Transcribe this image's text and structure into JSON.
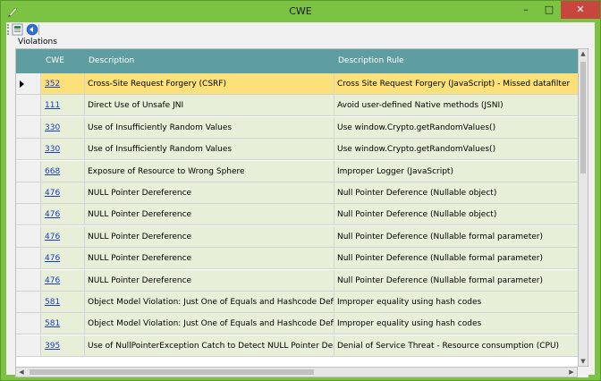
{
  "window": {
    "title": "CWE"
  },
  "titlebar_buttons": {
    "minimize": "–",
    "maximize": "□",
    "close": "✕"
  },
  "toolbar": {
    "icons": [
      "export-icon",
      "refresh-icon"
    ]
  },
  "group": {
    "label": "Violations"
  },
  "table": {
    "columns": [
      "CWE",
      "Description",
      "Description Rule"
    ],
    "selected_row": 0,
    "rows": [
      {
        "cwe": "352",
        "description": "Cross-Site Request Forgery (CSRF)",
        "rule": "Cross Site Request Forgery (JavaScript) - Missed datafilter"
      },
      {
        "cwe": "111",
        "description": "Direct Use of Unsafe JNI",
        "rule": "Avoid user-defined Native methods (JSNI)"
      },
      {
        "cwe": "330",
        "description": "Use of Insufficiently Random Values",
        "rule": "Use window.Crypto.getRandomValues()"
      },
      {
        "cwe": "330",
        "description": "Use of Insufficiently Random Values",
        "rule": "Use window.Crypto.getRandomValues()"
      },
      {
        "cwe": "668",
        "description": "Exposure of Resource to Wrong Sphere",
        "rule": "Improper Logger (JavaScript)"
      },
      {
        "cwe": "476",
        "description": "NULL Pointer Dereference",
        "rule": "Null Pointer Deference (Nullable object)"
      },
      {
        "cwe": "476",
        "description": "NULL Pointer Dereference",
        "rule": "Null Pointer Deference (Nullable object)"
      },
      {
        "cwe": "476",
        "description": "NULL Pointer Dereference",
        "rule": "Null Pointer Deference (Nullable formal parameter)"
      },
      {
        "cwe": "476",
        "description": "NULL Pointer Dereference",
        "rule": "Null Pointer Deference (Nullable formal parameter)"
      },
      {
        "cwe": "476",
        "description": "NULL Pointer Dereference",
        "rule": "Null Pointer Deference (Nullable formal parameter)"
      },
      {
        "cwe": "581",
        "description": "Object Model Violation: Just One of Equals and Hashcode Defined",
        "rule": "Improper equality using hash codes"
      },
      {
        "cwe": "581",
        "description": "Object Model Violation: Just One of Equals and Hashcode Defined",
        "rule": "Improper equality using hash codes"
      },
      {
        "cwe": "395",
        "description": "Use of NullPointerException Catch to Detect NULL Pointer Dereference",
        "rule": "Denial of Service Threat - Resource consumption (CPU)"
      }
    ]
  },
  "colors": {
    "header": "#5f9ea0",
    "row": "#e8efd8",
    "selected": "#fce17b",
    "titlebar": "#7cc343",
    "link": "#1a3cc8"
  }
}
